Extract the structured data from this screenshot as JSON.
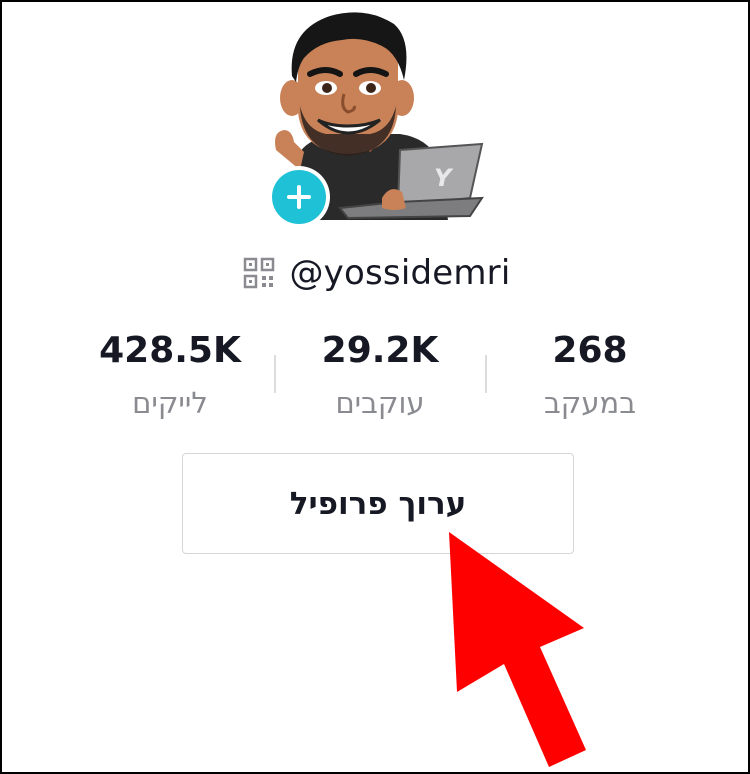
{
  "profile": {
    "username": "@yossidemri",
    "avatar_icon": "avatar-cartoon-man-with-laptop",
    "laptop_logo": "Y"
  },
  "stats": [
    {
      "value": "268",
      "label": "במעקב"
    },
    {
      "value": "29.2K",
      "label": "עוקבים"
    },
    {
      "value": "428.5K",
      "label": "לייקים"
    }
  ],
  "actions": {
    "edit_profile_label": "ערוך פרופיל",
    "add_icon": "plus-icon",
    "qr_icon": "qr-code-icon"
  },
  "colors": {
    "accent_teal": "#1fc1d6",
    "annotation_arrow": "#ff0000",
    "text_primary": "#161823",
    "text_secondary": "#8a8b91"
  }
}
